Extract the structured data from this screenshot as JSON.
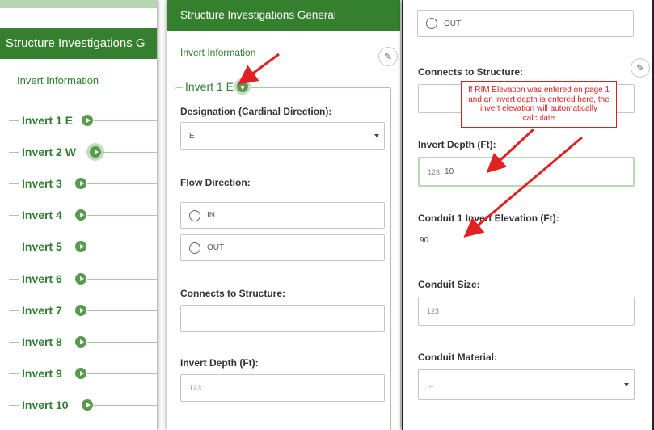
{
  "panel1": {
    "header_title": "Structure Investigations G",
    "section_title": "Invert Information",
    "inverts": [
      "Invert 1 E",
      "Invert 2 W",
      "Invert 3",
      "Invert 4",
      "Invert 5",
      "Invert 6",
      "Invert 7",
      "Invert 8",
      "Invert 9",
      "Invert 10"
    ]
  },
  "panel2": {
    "header_title": "Structure Investigations General",
    "section_title": "Invert Information",
    "group_legend": "Invert 1 E",
    "designation_label": "Designation (Cardinal Direction):",
    "designation_value": "E",
    "flow_label": "Flow Direction:",
    "flow_options": [
      "IN",
      "OUT"
    ],
    "connects_label": "Connects to Structure:",
    "connects_value": "",
    "depth_label": "Invert Depth (Ft):",
    "depth_icon": "123"
  },
  "panel3": {
    "flow_option_out": "OUT",
    "connects_label": "Connects to Structure:",
    "depth_label": "Invert Depth (Ft):",
    "depth_icon": "123",
    "depth_value": "10",
    "elevation_label": "Conduit 1 Invert Elevation (Ft):",
    "elevation_value": "90",
    "size_label": "Conduit Size:",
    "size_icon": "123",
    "material_label": "Conduit Material:",
    "material_value": "..."
  },
  "callout_text": "If RIM Elevation was entered on page 1 and an invert depth is entered here,  the invert elevation will automatically calculate",
  "icons": {
    "edit": "pencil-icon",
    "expand": "play-circle-icon",
    "collapse": "caret-down-circle-icon",
    "numeric": "numeric-123-icon",
    "radio": "radio-unchecked-icon",
    "select": "chevron-down-icon"
  },
  "colors": {
    "header_green": "#35802f",
    "accent_green": "#2e7d32",
    "button_green": "#5a9a4f",
    "annotation_red": "#d42020"
  }
}
